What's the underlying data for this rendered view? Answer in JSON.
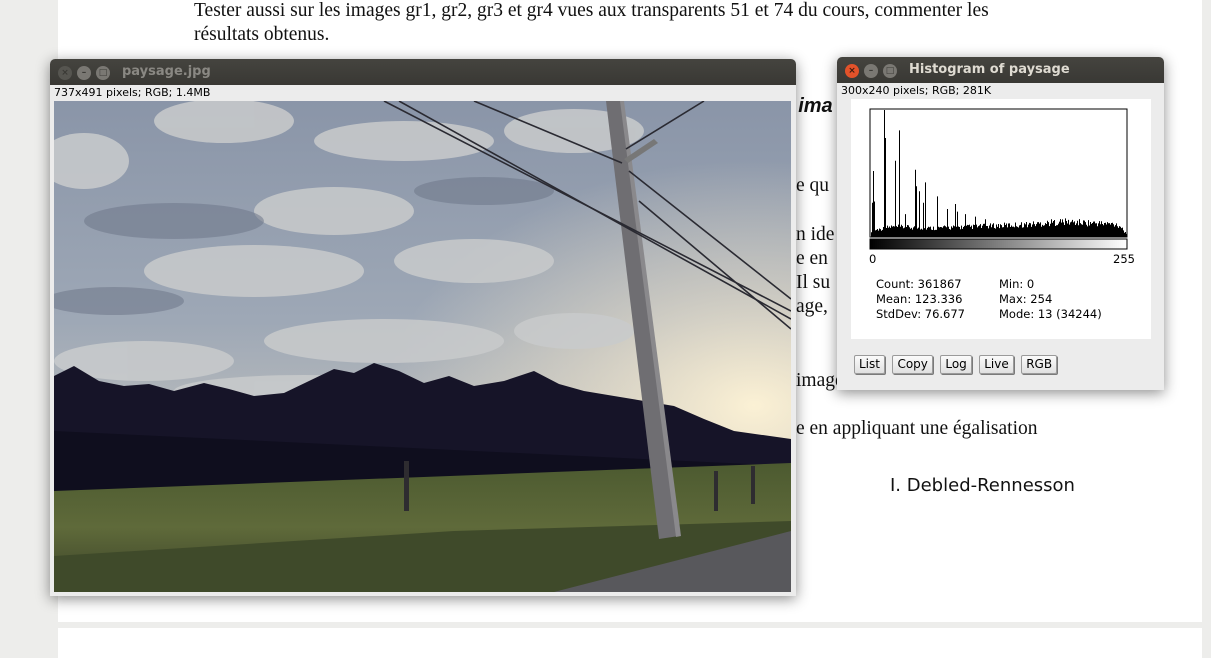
{
  "document": {
    "line1": "Tester aussi sur les images gr1, gr2, gr3 et gr4 vues aux transparents 51 et 74 du cours, commenter les",
    "line2": "résultats obtenus.",
    "frag_heading": "· ima",
    "frag_1": "e qu",
    "frag_2": "n  ide",
    "frag_3": "e en",
    "frag_4": "  Il su",
    "frag_5": "age,",
    "frag_6": "image",
    "frag_7": "e en appliquant  une égalisation",
    "signature": "I. Debled-Rennesson"
  },
  "image_window": {
    "title": "paysage.jpg",
    "info": "737x491 pixels; RGB; 1.4MB"
  },
  "histogram_window": {
    "title": "Histogram of paysage",
    "info": "300x240 pixels; RGB; 281K",
    "axis_min": "0",
    "axis_max": "255",
    "stats": {
      "count": "Count: 361867",
      "mean": "Mean: 123.336",
      "stddev": "StdDev: 76.677",
      "min": "Min: 0",
      "max": "Max: 254",
      "mode": "Mode: 13 (34244)"
    },
    "buttons": [
      "List",
      "Copy",
      "Log",
      "Live",
      "RGB"
    ]
  },
  "chart_data": {
    "type": "bar",
    "x_range": [
      0,
      255
    ],
    "mode_bin": 13,
    "mode_count": 34244,
    "peaks": [
      {
        "bin": 1,
        "rel": 0.27
      },
      {
        "bin": 2,
        "rel": 0.52
      },
      {
        "bin": 3,
        "rel": 0.28
      },
      {
        "bin": 13,
        "rel": 1.0
      },
      {
        "bin": 14,
        "rel": 0.78
      },
      {
        "bin": 24,
        "rel": 0.6
      },
      {
        "bin": 28,
        "rel": 0.84
      },
      {
        "bin": 34,
        "rel": 0.18
      },
      {
        "bin": 44,
        "rel": 0.53
      },
      {
        "bin": 45,
        "rel": 0.4
      },
      {
        "bin": 48,
        "rel": 0.36
      },
      {
        "bin": 52,
        "rel": 0.27
      },
      {
        "bin": 54,
        "rel": 0.43
      },
      {
        "bin": 66,
        "rel": 0.32
      },
      {
        "bin": 76,
        "rel": 0.22
      },
      {
        "bin": 84,
        "rel": 0.26
      },
      {
        "bin": 86,
        "rel": 0.2
      },
      {
        "bin": 94,
        "rel": 0.18
      },
      {
        "bin": 104,
        "rel": 0.16
      },
      {
        "bin": 114,
        "rel": 0.14
      }
    ],
    "baseline_envelope": [
      [
        0,
        0.05
      ],
      [
        20,
        0.08
      ],
      [
        60,
        0.07
      ],
      [
        100,
        0.08
      ],
      [
        130,
        0.09
      ],
      [
        160,
        0.1
      ],
      [
        190,
        0.12
      ],
      [
        220,
        0.11
      ],
      [
        245,
        0.1
      ],
      [
        250,
        0.08
      ],
      [
        255,
        0.02
      ]
    ]
  }
}
